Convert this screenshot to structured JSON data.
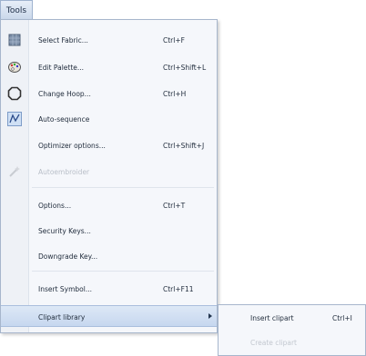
{
  "menubar": {
    "tools_label": "Tools"
  },
  "menu": {
    "items": [
      {
        "label": "Select Fabric...",
        "shortcut": "Ctrl+F",
        "icon": "fabric-icon",
        "enabled": true
      },
      {
        "label": "Edit Palette...",
        "shortcut": "Ctrl+Shift+L",
        "icon": "palette-icon",
        "enabled": true
      },
      {
        "label": "Change Hoop...",
        "shortcut": "Ctrl+H",
        "icon": "hoop-icon",
        "enabled": true
      },
      {
        "label": "Auto-sequence",
        "shortcut": "",
        "icon": "auto-sequence-icon",
        "enabled": true
      },
      {
        "label": "Optimizer options...",
        "shortcut": "Ctrl+Shift+J",
        "icon": "",
        "enabled": true
      },
      {
        "label": "Autoembroider",
        "shortcut": "",
        "icon": "wand-icon",
        "enabled": false
      },
      {
        "label": "Options...",
        "shortcut": "Ctrl+T",
        "icon": "",
        "enabled": true
      },
      {
        "label": "Security Keys...",
        "shortcut": "",
        "icon": "",
        "enabled": true
      },
      {
        "label": "Downgrade Key...",
        "shortcut": "",
        "icon": "",
        "enabled": true
      },
      {
        "label": "Insert Symbol...",
        "shortcut": "Ctrl+F11",
        "icon": "",
        "enabled": true
      },
      {
        "label": "Clipart library",
        "shortcut": "",
        "icon": "",
        "enabled": true,
        "highlighted": true,
        "has_submenu": true
      }
    ]
  },
  "submenu": {
    "items": [
      {
        "label": "Insert clipart",
        "shortcut": "Ctrl+I",
        "enabled": true
      },
      {
        "label": "Create clipart",
        "shortcut": "",
        "enabled": false
      }
    ]
  },
  "colors": {
    "highlight": "#c6d7ef",
    "menu_background": "#f5f7fb",
    "border": "#a7b6cc"
  }
}
